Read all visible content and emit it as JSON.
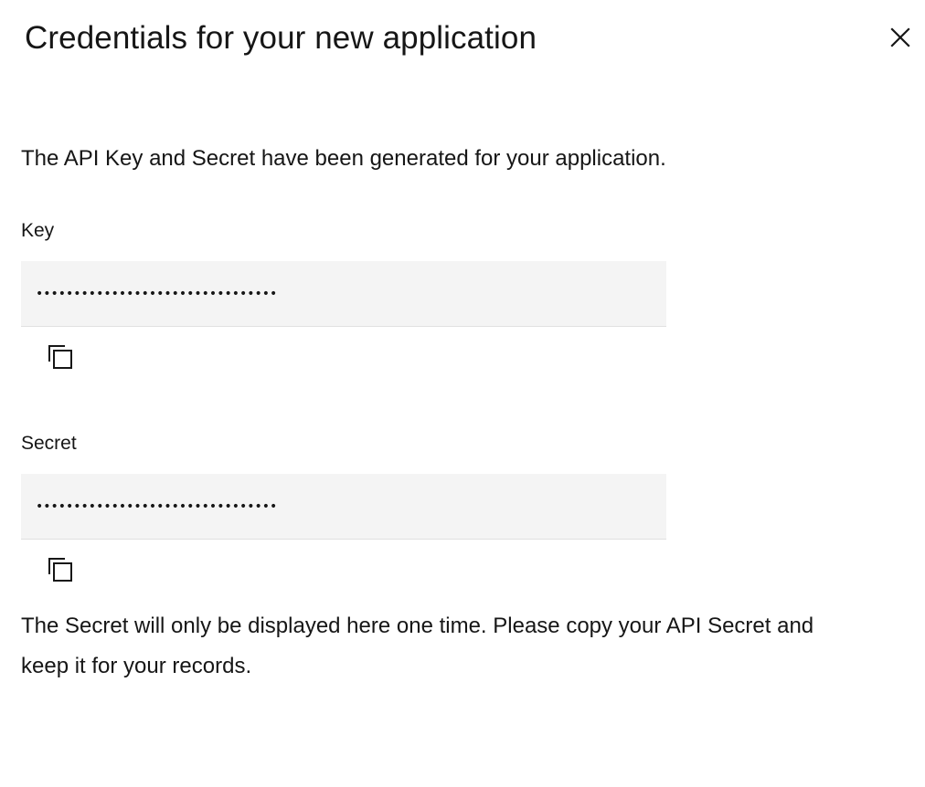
{
  "modal": {
    "title": "Credentials for your new application",
    "close_icon": "close-icon",
    "intro": "The API Key and Secret have been generated for your application.",
    "key": {
      "label": "Key",
      "value": "••••••••••••••••••••••••••••••••",
      "copy_icon": "copy-icon"
    },
    "secret": {
      "label": "Secret",
      "value": "••••••••••••••••••••••••••••••••",
      "copy_icon": "copy-icon"
    },
    "note": "The Secret will only be displayed here one time. Please copy your API Secret and keep it for your records."
  }
}
